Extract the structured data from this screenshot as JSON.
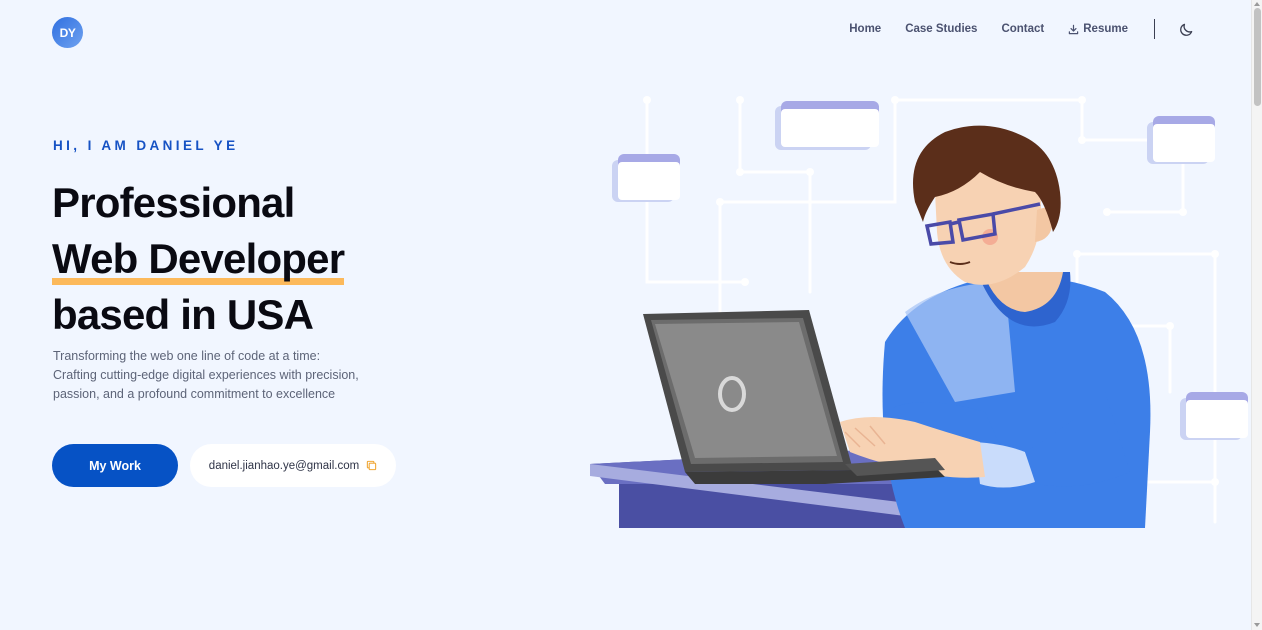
{
  "header": {
    "logo_text": "DY",
    "nav": [
      {
        "label": "Home"
      },
      {
        "label": "Case Studies"
      },
      {
        "label": "Contact"
      },
      {
        "label": "Resume",
        "icon": "download-icon"
      }
    ],
    "theme_toggle_icon": "moon-icon"
  },
  "hero": {
    "eyebrow": "HI, I AM DANIEL YE",
    "headline": {
      "line1": "Professional",
      "line2": "Web Developer",
      "line3": "based in USA"
    },
    "subtext": {
      "line1": "Transforming the web one line of code at a time:",
      "line2": "Crafting cutting-edge digital experiences with precision,",
      "line3": "passion, and a profound commitment to excellence"
    },
    "primary_button": "My Work",
    "email": "daniel.jianhao.ye@gmail.com",
    "email_icon": "copy-icon"
  },
  "illustration": {
    "subject": "developer-at-laptop-illustration"
  },
  "colors": {
    "background": "#f1f6ff",
    "accent": "#0652c5",
    "eyebrow": "#1652c4",
    "highlight": "#fcb95b",
    "sweater": "#3d7fe8",
    "panel": "#a7a9e6"
  }
}
